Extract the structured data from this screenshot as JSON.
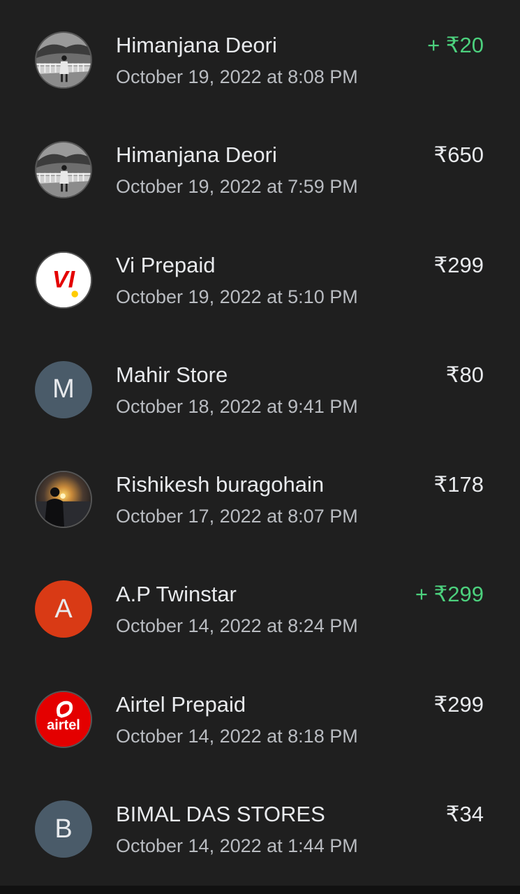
{
  "transactions": [
    {
      "name": "Himanjana Deori",
      "date": "October 19, 2022 at 8:08 PM",
      "amount": "+ ₹20",
      "direction": "credit",
      "avatar": {
        "kind": "photo",
        "icon": "person-bridge-photo-icon"
      }
    },
    {
      "name": "Himanjana Deori",
      "date": "October 19, 2022 at 7:59 PM",
      "amount": "₹650",
      "direction": "debit",
      "avatar": {
        "kind": "photo",
        "icon": "person-bridge-photo-icon"
      }
    },
    {
      "name": "Vi Prepaid",
      "date": "October 19, 2022 at 5:10 PM",
      "amount": "₹299",
      "direction": "debit",
      "avatar": {
        "kind": "logo",
        "icon": "vi-logo-icon",
        "logo_text": "VI"
      }
    },
    {
      "name": "Mahir Store",
      "date": "October 18, 2022 at 9:41 PM",
      "amount": "₹80",
      "direction": "debit",
      "avatar": {
        "kind": "letter",
        "letter": "M",
        "color": "#4a5b69"
      }
    },
    {
      "name": "Rishikesh buragohain",
      "date": "October 17, 2022 at 8:07 PM",
      "amount": "₹178",
      "direction": "debit",
      "avatar": {
        "kind": "photo",
        "icon": "sunset-person-photo-icon"
      }
    },
    {
      "name": "A.P Twinstar",
      "date": "October 14, 2022 at 8:24 PM",
      "amount": "+ ₹299",
      "direction": "credit",
      "avatar": {
        "kind": "letter",
        "letter": "A",
        "color": "#d93a15"
      }
    },
    {
      "name": "Airtel Prepaid",
      "date": "October 14, 2022 at 8:18 PM",
      "amount": "₹299",
      "direction": "debit",
      "avatar": {
        "kind": "logo",
        "icon": "airtel-logo-icon",
        "logo_text": "airtel"
      }
    },
    {
      "name": "BIMAL DAS STORES",
      "date": "October 14, 2022 at 1:44 PM",
      "amount": "₹34",
      "direction": "debit",
      "avatar": {
        "kind": "letter",
        "letter": "B",
        "color": "#4a5b69"
      }
    }
  ],
  "colors": {
    "background": "#1f1f1f",
    "credit": "#4cd07d",
    "primary_text": "#e8eaed",
    "secondary_text": "#b9bcc1"
  }
}
